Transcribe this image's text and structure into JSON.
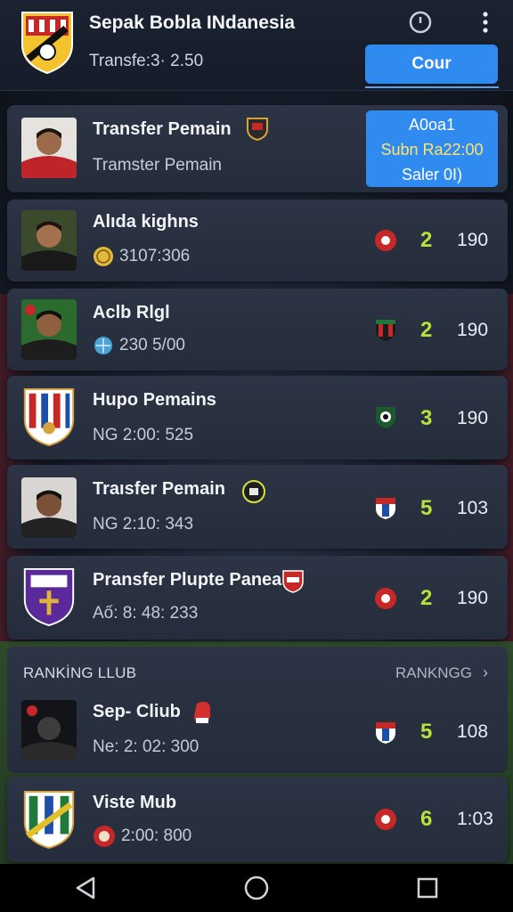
{
  "header": {
    "title": "Sepak Bobla INdanesia",
    "subtitle": "Transfe:3· 2.50",
    "cta_label": "Cour",
    "icons": [
      "app-logo-icon",
      "clock-icon",
      "more-vert-icon"
    ]
  },
  "featured": {
    "title": "Transfer Pemain",
    "subtitle": "Tramster Pemain",
    "promo": {
      "line1": "A0oa1",
      "line2": "Subn Ra22:00",
      "line3": "Saler 0I)"
    },
    "accent": "#2f8bf0"
  },
  "items": [
    {
      "name": "Alıda kighns",
      "meta": "3107:306",
      "meta_icon": "coin-icon",
      "score": "2",
      "value": "190"
    },
    {
      "name": "Aclb Rlgl",
      "meta": "230 5/00",
      "meta_icon": "ball-icon",
      "score": "2",
      "value": "190"
    },
    {
      "name": "Hupo Pemains",
      "meta": "NG 2:00: 525",
      "meta_icon": "",
      "score": "3",
      "value": "190"
    },
    {
      "name": "Traısfer Pemain",
      "meta": "NG 2:10: 343",
      "meta_icon": "",
      "score": "5",
      "value": "103"
    },
    {
      "name": "Pransfer Plupte Panea",
      "meta": "Aố: 8: 48: 233",
      "meta_icon": "",
      "score": "2",
      "value": "190"
    }
  ],
  "ranking": {
    "title": "RANKİNG LLUB",
    "link": "RANKNGG",
    "items": [
      {
        "name": "Sep- Cliub",
        "meta": "Ne: 2: 02: 300",
        "score": "5",
        "value": "108"
      },
      {
        "name": "Viste Mub",
        "meta": "2:00: 800",
        "score": "6",
        "value": "1:03"
      }
    ]
  },
  "colors": {
    "score": "#b6e23c",
    "accent": "#2f8bf0",
    "card": "#2a3242"
  },
  "navbar": {
    "icons": [
      "back-icon",
      "home-icon",
      "recents-icon"
    ]
  }
}
